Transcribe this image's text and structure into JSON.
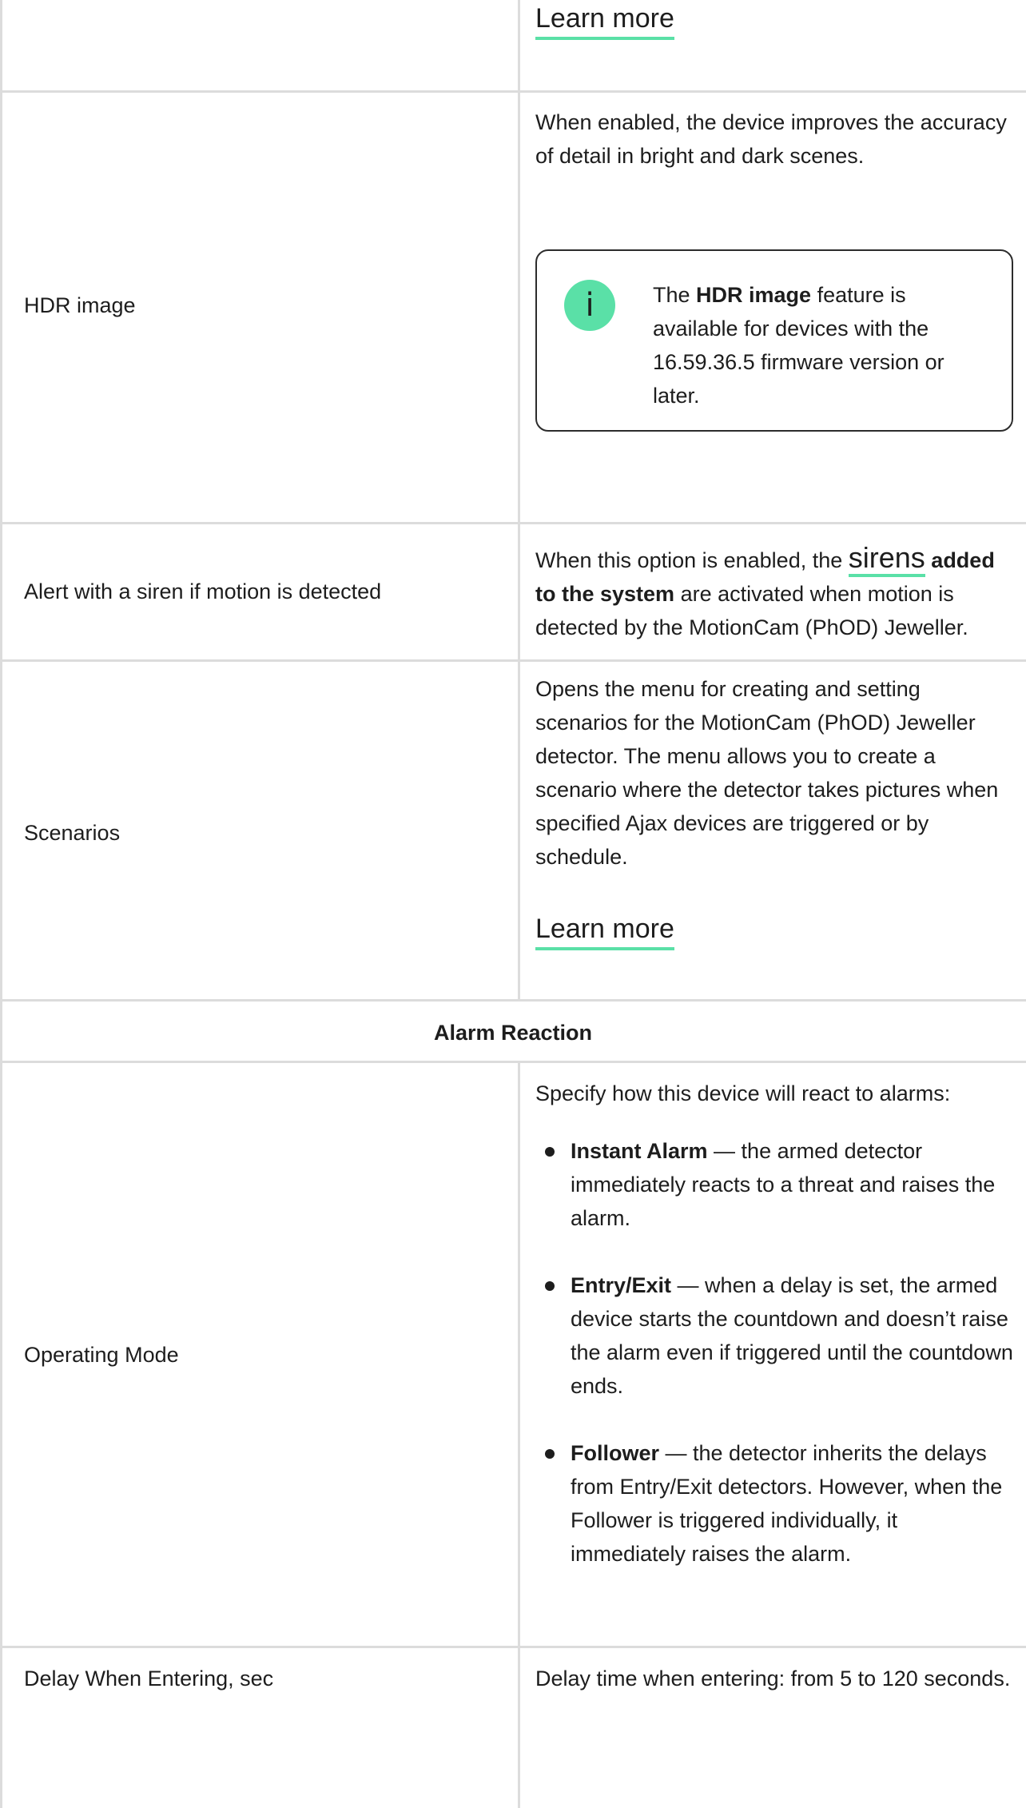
{
  "top": {
    "learn_more": "Learn more"
  },
  "hdr": {
    "label": "HDR image",
    "description": "When enabled, the device improves the accuracy of detail in bright and dark scenes.",
    "note_pre": "The ",
    "note_bold": "HDR image",
    "note_post": " feature is available for devices with the 16.59.36.5 firmware version or later.",
    "note_icon": "i"
  },
  "siren": {
    "label": "Alert with a siren if motion is detected",
    "desc_pre": "When this option is enabled, the ",
    "desc_link": "sirens",
    "desc_bold": " added to the system",
    "desc_post": " are activated when motion is detected by the MotionCam (PhOD) Jeweller."
  },
  "scenarios": {
    "label": "Scenarios",
    "description": "Opens the menu for creating and setting scenarios for the MotionCam (PhOD) Jeweller detector. The menu allows you to create a scenario where the detector takes pictures when specified Ajax devices are triggered or by schedule.",
    "learn_more": "Learn more"
  },
  "section": {
    "title": "Alarm Reaction"
  },
  "operating_mode": {
    "label": "Operating Mode",
    "intro": "Specify how this device will react to alarms:",
    "items": [
      {
        "term": "Instant Alarm",
        "text": " — the armed detector immediately reacts to a threat and raises the alarm."
      },
      {
        "term": "Entry/Exit",
        "text": " — when a delay is set, the armed device starts the countdown and doesn’t raise the alarm even if triggered until the countdown ends."
      },
      {
        "term": "Follower",
        "text": " — the detector inherits the delays from Entry/Exit detectors. However, when the Follower is triggered individually, it immediately raises the alarm."
      }
    ]
  },
  "delay_entering": {
    "label": "Delay When Entering, sec",
    "description": "Delay time when entering: from 5 to 120 seconds."
  },
  "colors": {
    "accent": "#5ae0a7",
    "border": "#dcdcdc",
    "text": "#1d1d1d"
  }
}
